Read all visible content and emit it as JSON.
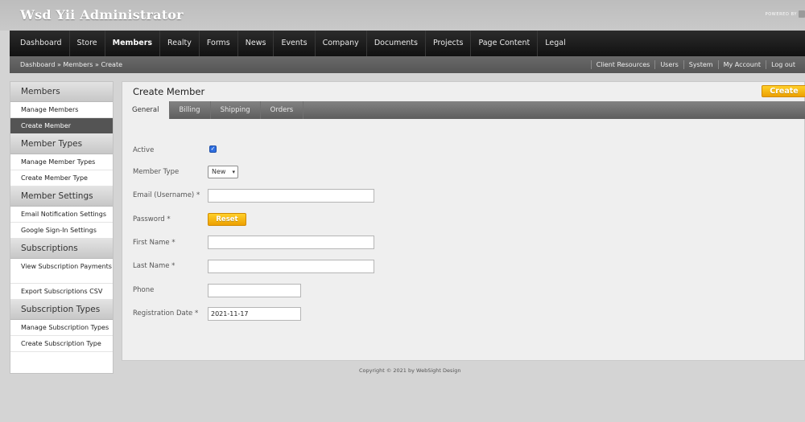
{
  "app": {
    "title": "Wsd Yii Administrator",
    "powered_by": "POWERED BY"
  },
  "nav": [
    {
      "label": "Dashboard"
    },
    {
      "label": "Store"
    },
    {
      "label": "Members"
    },
    {
      "label": "Realty"
    },
    {
      "label": "Forms"
    },
    {
      "label": "News"
    },
    {
      "label": "Events"
    },
    {
      "label": "Company"
    },
    {
      "label": "Documents"
    },
    {
      "label": "Projects"
    },
    {
      "label": "Page Content"
    },
    {
      "label": "Legal"
    }
  ],
  "breadcrumb": "Dashboard » Members » Create",
  "util_links": [
    {
      "label": "Client Resources"
    },
    {
      "label": "Users"
    },
    {
      "label": "System"
    },
    {
      "label": "My Account"
    },
    {
      "label": "Log out"
    }
  ],
  "sidebar": {
    "members": {
      "title": "Members",
      "items": [
        {
          "label": "Manage Members"
        },
        {
          "label": "Create Member"
        }
      ]
    },
    "member_types": {
      "title": "Member Types",
      "items": [
        {
          "label": "Manage Member Types"
        },
        {
          "label": "Create Member Type"
        }
      ]
    },
    "member_settings": {
      "title": "Member Settings",
      "items": [
        {
          "label": "Email Notification Settings"
        },
        {
          "label": "Google Sign-In Settings"
        }
      ]
    },
    "subscriptions": {
      "title": "Subscriptions",
      "items": [
        {
          "label": "View Subscription Payments"
        },
        {
          "label": "Export Subscriptions CSV"
        }
      ]
    },
    "subscription_types": {
      "title": "Subscription Types",
      "items": [
        {
          "label": "Manage Subscription Types"
        },
        {
          "label": "Create Subscription Type"
        }
      ]
    }
  },
  "main": {
    "title": "Create Member",
    "create_label": "Create",
    "tabs": [
      {
        "label": "General"
      },
      {
        "label": "Billing"
      },
      {
        "label": "Shipping"
      },
      {
        "label": "Orders"
      }
    ]
  },
  "form": {
    "active_label": "Active",
    "active_checked": true,
    "member_type_label": "Member Type",
    "member_type_value": "New",
    "email_label": "Email (Username) *",
    "email_value": "",
    "password_label": "Password *",
    "reset_label": "Reset",
    "first_name_label": "First Name *",
    "first_name_value": "",
    "last_name_label": "Last Name *",
    "last_name_value": "",
    "phone_label": "Phone",
    "phone_value": "",
    "registration_date_label": "Registration Date *",
    "registration_date_value": "2021-11-17"
  },
  "footer": "Copyright © 2021 by WebSight Design",
  "colors": {
    "accent": "#f5b800",
    "nav_bg": "#1a1a1a",
    "subbar_bg": "#5e5e5e",
    "active_sidebar": "#545454",
    "checkbox": "#2f6ee0"
  }
}
